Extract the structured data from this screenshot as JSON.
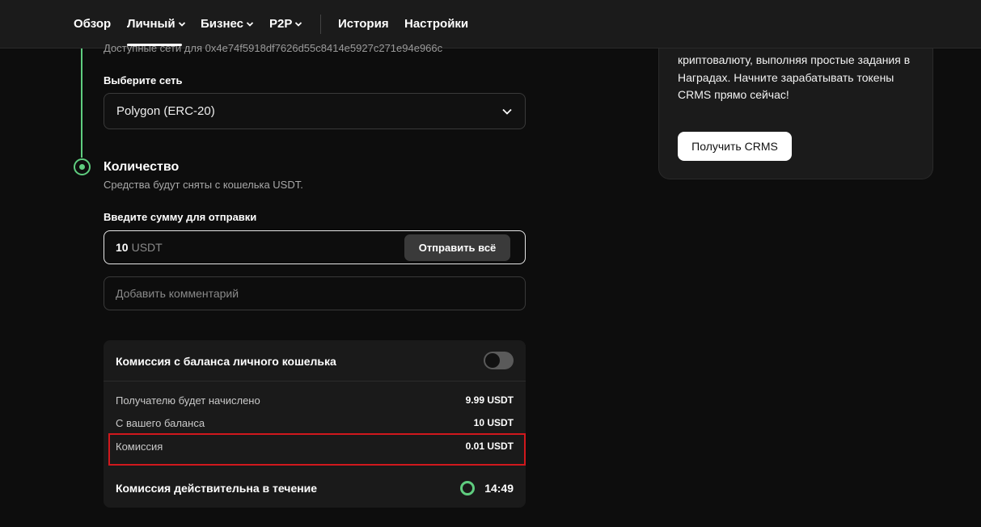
{
  "nav": {
    "items": [
      {
        "label": "Обзор",
        "dropdown": false
      },
      {
        "label": "Личный",
        "dropdown": true,
        "active": true
      },
      {
        "label": "Бизнес",
        "dropdown": true
      },
      {
        "label": "P2P",
        "dropdown": true
      },
      {
        "label": "История",
        "dropdown": false
      },
      {
        "label": "Настройки",
        "dropdown": false
      }
    ]
  },
  "network": {
    "cut_text": "Доступные сети для 0x4e74f5918df7626d55c8414e5927c271e94e966c",
    "label": "Выберите сеть",
    "selected": "Polygon (ERC-20)"
  },
  "amount_section": {
    "title": "Количество",
    "subtitle": "Средства будут сняты с кошелька USDT.",
    "input_label": "Введите сумму для отправки",
    "value": "10",
    "unit": "USDT",
    "send_all_label": "Отправить всё",
    "comment_placeholder": "Добавить комментарий"
  },
  "fee": {
    "header": "Комиссия с баланса личного кошелька",
    "toggle_on": false,
    "rows": [
      {
        "label": "Получателю будет начислено",
        "value": "9.99 USDT"
      },
      {
        "label": "С вашего баланса",
        "value": "10 USDT"
      },
      {
        "label": "Комиссия",
        "value": "0.01 USDT"
      }
    ],
    "validity_label": "Комиссия действительна в течение",
    "timer": "14:49"
  },
  "promo": {
    "text": "криптовалюту, выполняя простые задания в Наградах. Начните зарабатывать токены CRMS прямо сейчас!",
    "button_label": "Получить CRMS"
  },
  "colors": {
    "accent_green": "#5fcd7f",
    "highlight_red": "#d0181d",
    "background": "#0d0d0d"
  }
}
